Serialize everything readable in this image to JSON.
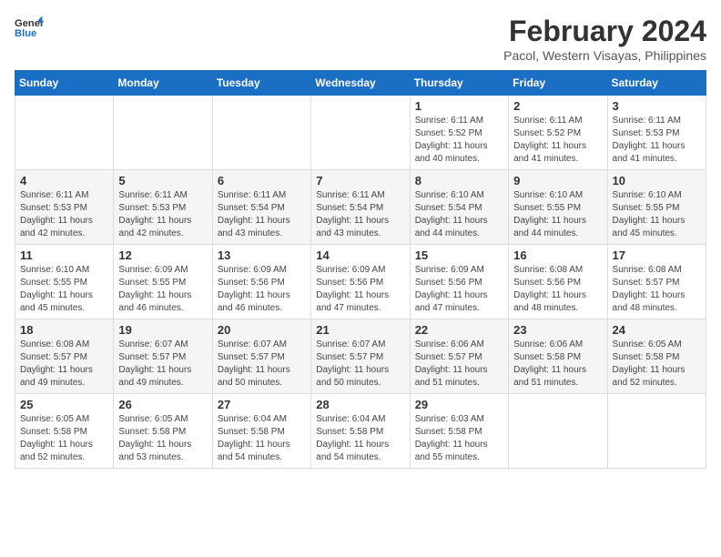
{
  "header": {
    "logo_line1": "General",
    "logo_line2": "Blue",
    "month_year": "February 2024",
    "location": "Pacol, Western Visayas, Philippines"
  },
  "weekdays": [
    "Sunday",
    "Monday",
    "Tuesday",
    "Wednesday",
    "Thursday",
    "Friday",
    "Saturday"
  ],
  "weeks": [
    [
      {
        "day": "",
        "info": ""
      },
      {
        "day": "",
        "info": ""
      },
      {
        "day": "",
        "info": ""
      },
      {
        "day": "",
        "info": ""
      },
      {
        "day": "1",
        "info": "Sunrise: 6:11 AM\nSunset: 5:52 PM\nDaylight: 11 hours\nand 40 minutes."
      },
      {
        "day": "2",
        "info": "Sunrise: 6:11 AM\nSunset: 5:52 PM\nDaylight: 11 hours\nand 41 minutes."
      },
      {
        "day": "3",
        "info": "Sunrise: 6:11 AM\nSunset: 5:53 PM\nDaylight: 11 hours\nand 41 minutes."
      }
    ],
    [
      {
        "day": "4",
        "info": "Sunrise: 6:11 AM\nSunset: 5:53 PM\nDaylight: 11 hours\nand 42 minutes."
      },
      {
        "day": "5",
        "info": "Sunrise: 6:11 AM\nSunset: 5:53 PM\nDaylight: 11 hours\nand 42 minutes."
      },
      {
        "day": "6",
        "info": "Sunrise: 6:11 AM\nSunset: 5:54 PM\nDaylight: 11 hours\nand 43 minutes."
      },
      {
        "day": "7",
        "info": "Sunrise: 6:11 AM\nSunset: 5:54 PM\nDaylight: 11 hours\nand 43 minutes."
      },
      {
        "day": "8",
        "info": "Sunrise: 6:10 AM\nSunset: 5:54 PM\nDaylight: 11 hours\nand 44 minutes."
      },
      {
        "day": "9",
        "info": "Sunrise: 6:10 AM\nSunset: 5:55 PM\nDaylight: 11 hours\nand 44 minutes."
      },
      {
        "day": "10",
        "info": "Sunrise: 6:10 AM\nSunset: 5:55 PM\nDaylight: 11 hours\nand 45 minutes."
      }
    ],
    [
      {
        "day": "11",
        "info": "Sunrise: 6:10 AM\nSunset: 5:55 PM\nDaylight: 11 hours\nand 45 minutes."
      },
      {
        "day": "12",
        "info": "Sunrise: 6:09 AM\nSunset: 5:55 PM\nDaylight: 11 hours\nand 46 minutes."
      },
      {
        "day": "13",
        "info": "Sunrise: 6:09 AM\nSunset: 5:56 PM\nDaylight: 11 hours\nand 46 minutes."
      },
      {
        "day": "14",
        "info": "Sunrise: 6:09 AM\nSunset: 5:56 PM\nDaylight: 11 hours\nand 47 minutes."
      },
      {
        "day": "15",
        "info": "Sunrise: 6:09 AM\nSunset: 5:56 PM\nDaylight: 11 hours\nand 47 minutes."
      },
      {
        "day": "16",
        "info": "Sunrise: 6:08 AM\nSunset: 5:56 PM\nDaylight: 11 hours\nand 48 minutes."
      },
      {
        "day": "17",
        "info": "Sunrise: 6:08 AM\nSunset: 5:57 PM\nDaylight: 11 hours\nand 48 minutes."
      }
    ],
    [
      {
        "day": "18",
        "info": "Sunrise: 6:08 AM\nSunset: 5:57 PM\nDaylight: 11 hours\nand 49 minutes."
      },
      {
        "day": "19",
        "info": "Sunrise: 6:07 AM\nSunset: 5:57 PM\nDaylight: 11 hours\nand 49 minutes."
      },
      {
        "day": "20",
        "info": "Sunrise: 6:07 AM\nSunset: 5:57 PM\nDaylight: 11 hours\nand 50 minutes."
      },
      {
        "day": "21",
        "info": "Sunrise: 6:07 AM\nSunset: 5:57 PM\nDaylight: 11 hours\nand 50 minutes."
      },
      {
        "day": "22",
        "info": "Sunrise: 6:06 AM\nSunset: 5:57 PM\nDaylight: 11 hours\nand 51 minutes."
      },
      {
        "day": "23",
        "info": "Sunrise: 6:06 AM\nSunset: 5:58 PM\nDaylight: 11 hours\nand 51 minutes."
      },
      {
        "day": "24",
        "info": "Sunrise: 6:05 AM\nSunset: 5:58 PM\nDaylight: 11 hours\nand 52 minutes."
      }
    ],
    [
      {
        "day": "25",
        "info": "Sunrise: 6:05 AM\nSunset: 5:58 PM\nDaylight: 11 hours\nand 52 minutes."
      },
      {
        "day": "26",
        "info": "Sunrise: 6:05 AM\nSunset: 5:58 PM\nDaylight: 11 hours\nand 53 minutes."
      },
      {
        "day": "27",
        "info": "Sunrise: 6:04 AM\nSunset: 5:58 PM\nDaylight: 11 hours\nand 54 minutes."
      },
      {
        "day": "28",
        "info": "Sunrise: 6:04 AM\nSunset: 5:58 PM\nDaylight: 11 hours\nand 54 minutes."
      },
      {
        "day": "29",
        "info": "Sunrise: 6:03 AM\nSunset: 5:58 PM\nDaylight: 11 hours\nand 55 minutes."
      },
      {
        "day": "",
        "info": ""
      },
      {
        "day": "",
        "info": ""
      }
    ]
  ]
}
